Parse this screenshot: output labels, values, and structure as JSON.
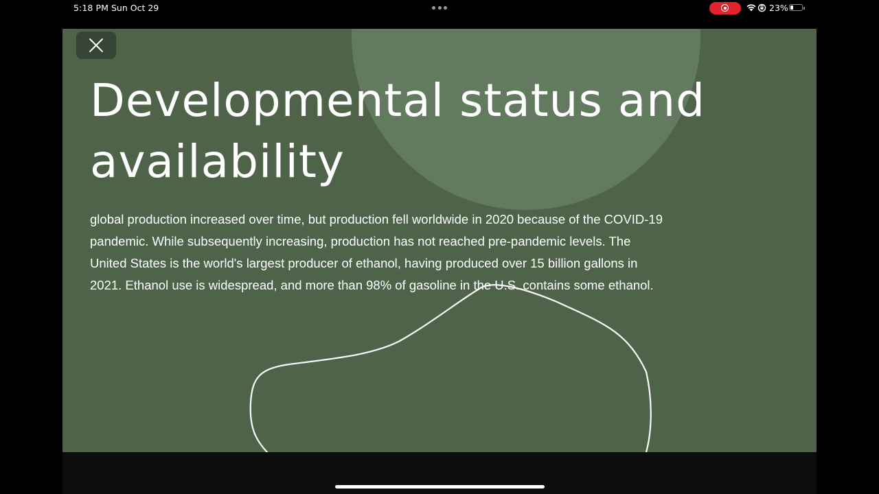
{
  "status_bar": {
    "time": "5:18 PM",
    "date": "Sun Oct 29",
    "battery_percent": "23%",
    "battery_level": 0.23,
    "icons": [
      "screen-record-icon",
      "wifi-icon",
      "orientation-lock-icon",
      "battery-icon"
    ]
  },
  "slide": {
    "title": "Developmental status and availability",
    "body": "global production increased over time, but production fell worldwide in 2020 because of the COVID-19 pandemic. While subsequently increasing, production has not reached pre-pandemic levels. The United States is the world's largest producer of ethanol, having produced over 15 billion gallons in 2021. Ethanol use is widespread, and more than 98% of gasoline in the U.S. contains some ethanol.",
    "close_icon": "close-icon"
  },
  "colors": {
    "slide_background": "#4f6349",
    "decorative_circle": "#627a5d",
    "text": "#ffffff",
    "record_indicator": "#e0232c"
  }
}
